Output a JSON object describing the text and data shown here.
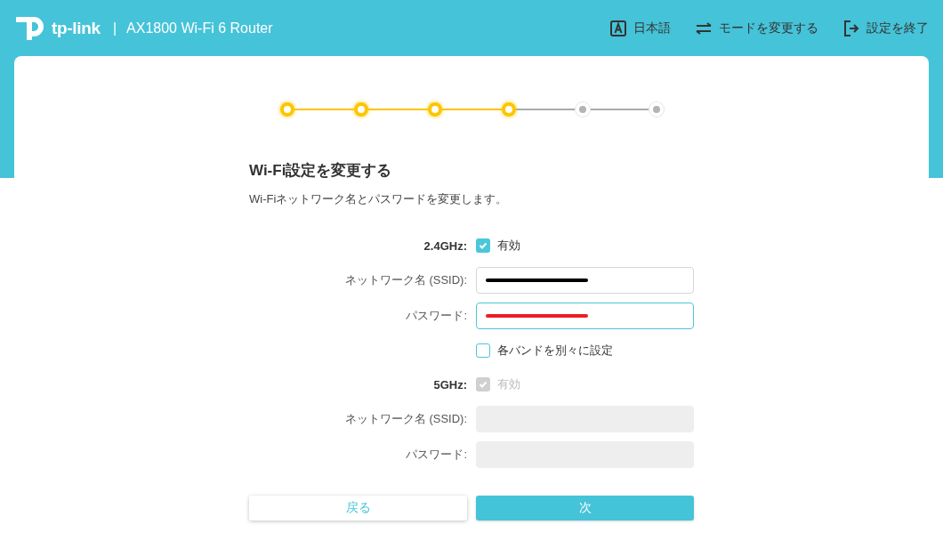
{
  "header": {
    "brand": "tp-link",
    "separator": "|",
    "product": "AX1800 Wi-Fi 6 Router",
    "nav": [
      {
        "kind": "language",
        "label": "日本語"
      },
      {
        "kind": "mode",
        "label": "モードを変更する"
      },
      {
        "kind": "exit",
        "label": "設定を終了"
      }
    ]
  },
  "steps": [
    {
      "completed": true
    },
    {
      "completed": true
    },
    {
      "completed": true
    },
    {
      "completed": true
    },
    {
      "completed": false
    },
    {
      "completed": false
    }
  ],
  "title": "Wi-Fi設定を変更する",
  "subtitle": "Wi-Fiネットワーク名とパスワードを変更します。",
  "form": [
    {
      "kind": "band",
      "label": "2.4GHz:",
      "option": "有効",
      "checked": true,
      "disabled": false
    },
    {
      "kind": "field",
      "label": "ネットワーク名 (SSID):",
      "disabled": false,
      "focused": false,
      "color": "#000000"
    },
    {
      "kind": "field",
      "label": "パスワード:",
      "disabled": false,
      "focused": true,
      "color": "#ee1c25"
    },
    {
      "kind": "option",
      "option": "各バンドを別々に設定",
      "checked": false
    },
    {
      "kind": "band",
      "label": "5GHz:",
      "option": "有効",
      "checked": true,
      "disabled": true
    },
    {
      "kind": "field",
      "label": "ネットワーク名 (SSID):",
      "disabled": true,
      "focused": false
    },
    {
      "kind": "field",
      "label": "パスワード:",
      "disabled": true,
      "focused": false
    }
  ],
  "buttons": [
    {
      "kind": "secondary",
      "label": "戻る"
    },
    {
      "kind": "primary",
      "label": "次"
    }
  ]
}
